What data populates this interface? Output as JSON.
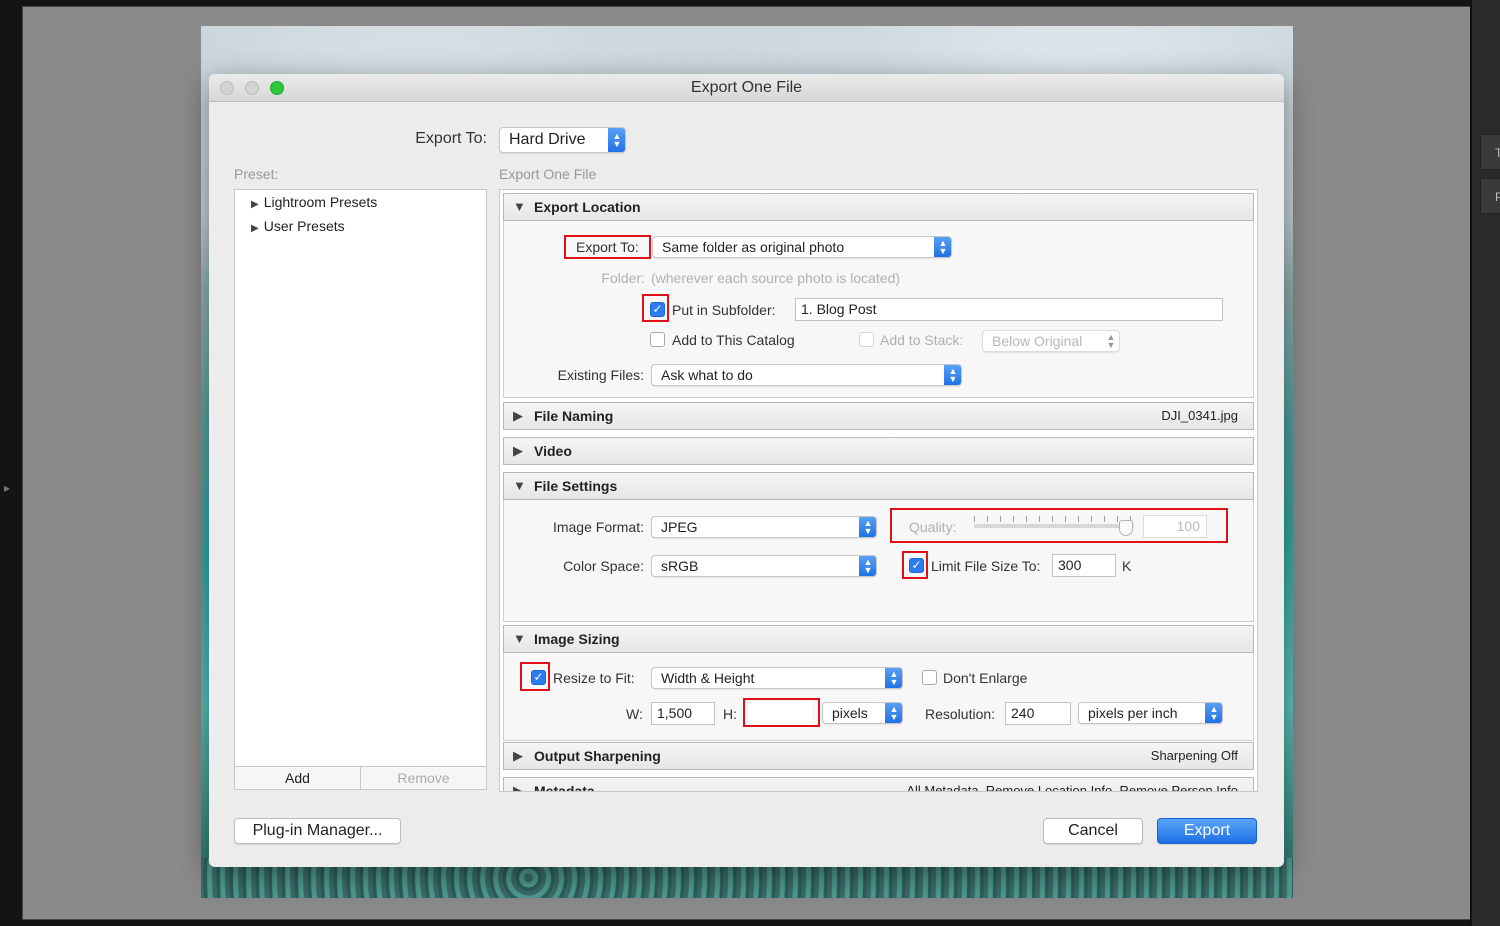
{
  "dialog": {
    "title": "Export One File",
    "export_to_label": "Export To:",
    "export_to_value": "Hard Drive"
  },
  "presets": {
    "label": "Preset:",
    "items": [
      "Lightroom Presets",
      "User Presets"
    ],
    "add_label": "Add",
    "remove_label": "Remove"
  },
  "settings": {
    "breadcrumb": "Export One File",
    "export_location": {
      "title": "Export Location",
      "export_to_label": "Export To:",
      "export_to_value": "Same folder as original photo",
      "folder_label": "Folder:",
      "folder_value": "(wherever each source photo is located)",
      "subfolder_label": "Put in Subfolder:",
      "subfolder_checked": true,
      "subfolder_value": "1. Blog Post",
      "add_catalog_label": "Add to This Catalog",
      "add_stack_label": "Add to Stack:",
      "stack_value": "Below Original",
      "existing_files_label": "Existing Files:",
      "existing_files_value": "Ask what to do"
    },
    "file_naming": {
      "title": "File Naming",
      "summary": "DJI_0341.jpg"
    },
    "video": {
      "title": "Video"
    },
    "file_settings": {
      "title": "File Settings",
      "image_format_label": "Image Format:",
      "image_format_value": "JPEG",
      "quality_label": "Quality:",
      "quality_value": "100",
      "color_space_label": "Color Space:",
      "color_space_value": "sRGB",
      "limit_label": "Limit File Size To:",
      "limit_value": "300",
      "limit_unit": "K"
    },
    "image_sizing": {
      "title": "Image Sizing",
      "resize_label": "Resize to Fit:",
      "resize_value": "Width & Height",
      "dont_enlarge_label": "Don't Enlarge",
      "w_label": "W:",
      "w_value": "1,500",
      "h_label": "H:",
      "h_value": "",
      "units_value": "pixels",
      "resolution_label": "Resolution:",
      "resolution_value": "240",
      "resolution_units": "pixels per inch"
    },
    "output_sharpening": {
      "title": "Output Sharpening",
      "summary": "Sharpening Off"
    },
    "metadata": {
      "title": "Metadata",
      "summary": "All Metadata, Remove Location Info, Remove Person Info"
    }
  },
  "footer": {
    "plugin_manager_label": "Plug-in Manager...",
    "cancel_label": "Cancel",
    "export_label": "Export"
  },
  "right_strip": {
    "tab1": "T",
    "tab2": "P"
  },
  "colors": {
    "accent": "#2b7cf0",
    "highlight": "#e0101b",
    "traffic_green": "#2bc840"
  }
}
